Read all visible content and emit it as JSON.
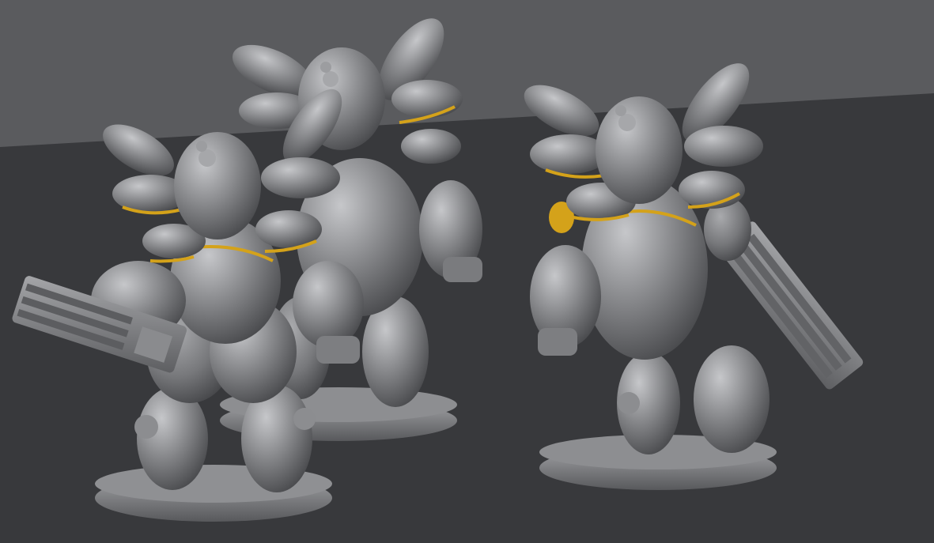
{
  "scene": {
    "colors": {
      "wall": "#5a5b5e",
      "floor": "#38393c",
      "model_light": "#b4b5b8",
      "model_mid": "#8e8f92",
      "model_dark": "#4f5053",
      "accent_yellow": "#d4a21a"
    },
    "models": [
      {
        "name": "robot-left",
        "pose": "back-view",
        "weapon": "rotary-cannon-left-arm"
      },
      {
        "name": "robot-center",
        "pose": "back-view",
        "weapon": "none"
      },
      {
        "name": "robot-right",
        "pose": "back-view",
        "weapon": "rotary-cannon-right-arm"
      }
    ]
  }
}
